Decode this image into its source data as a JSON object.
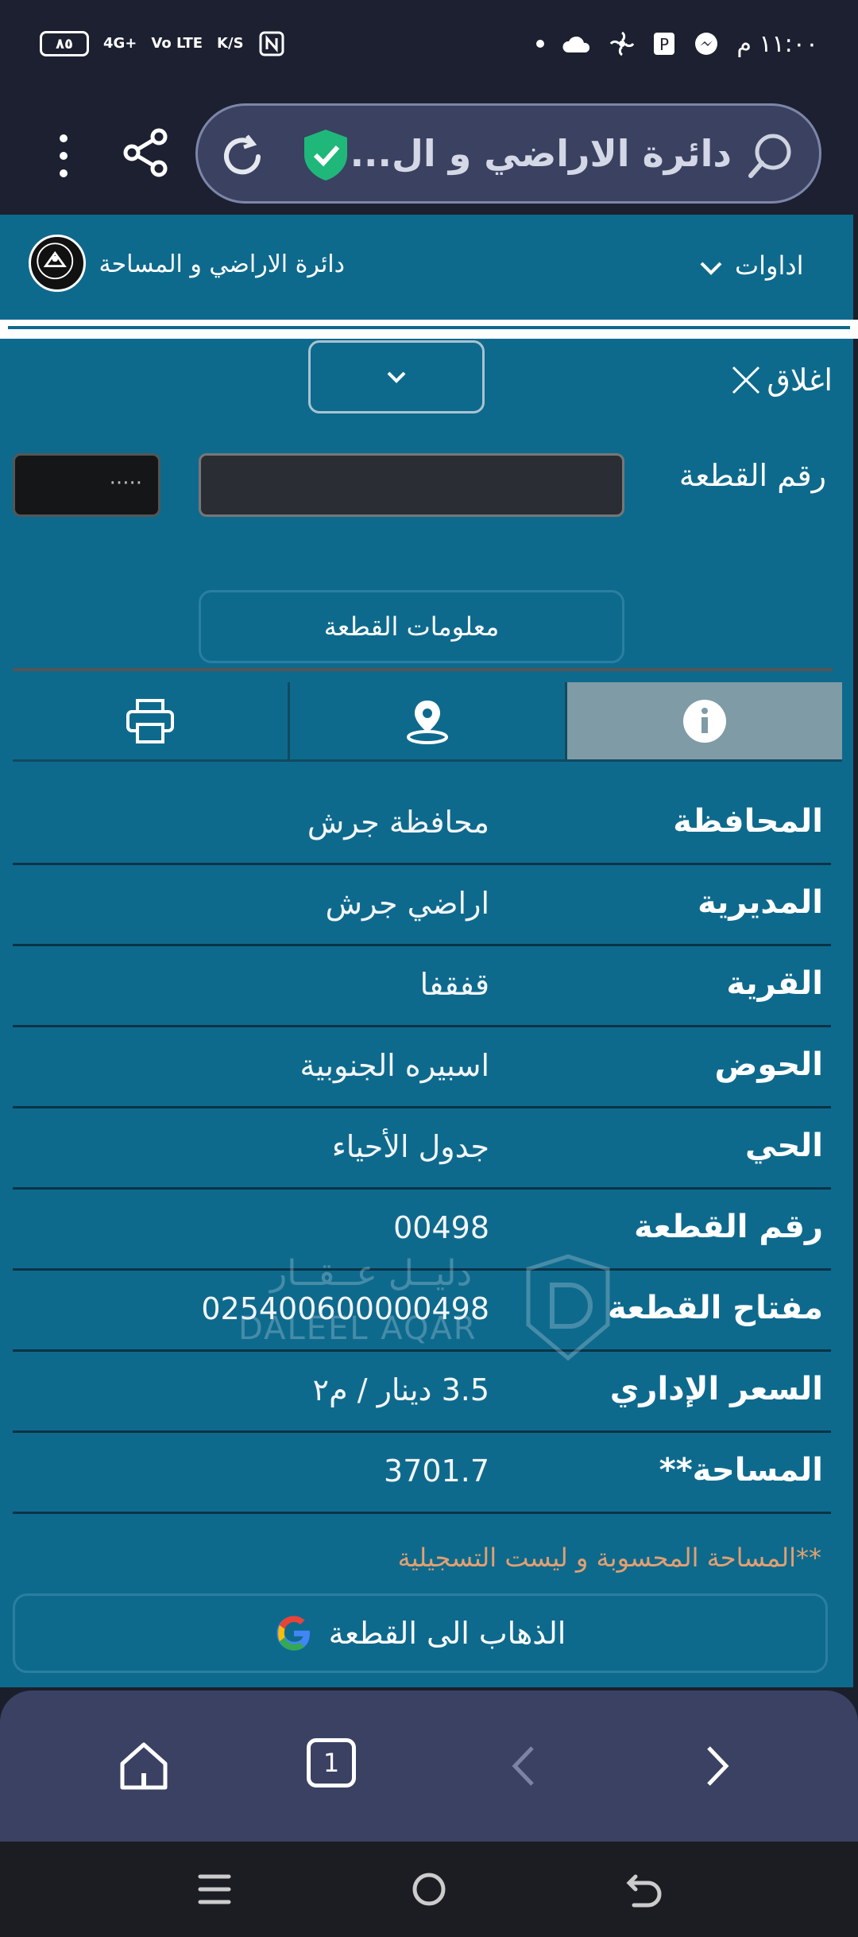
{
  "status_bar": {
    "time": "١١:٠٠ م",
    "battery": "٨٥",
    "network": "4G+",
    "volte": "Vo LTE",
    "speed": "K/S"
  },
  "browser": {
    "url_title": "دائرة الاراضي و ال...",
    "tab_count": "1"
  },
  "site": {
    "title": "دائرة الاراضي و المساحة",
    "tools_label": "اداوات"
  },
  "panel": {
    "close_label": "اغلاق",
    "plot_number_label": "رقم القطعة",
    "small_input_value": "·····",
    "plot_info_button": "معلومات القطعة",
    "fields": [
      {
        "key": "المحافظة",
        "value": "محافظة جرش"
      },
      {
        "key": "المديرية",
        "value": "اراضي جرش"
      },
      {
        "key": "القرية",
        "value": "قفقفا"
      },
      {
        "key": "الحوض",
        "value": "اسبيره الجنوبية"
      },
      {
        "key": "الحي",
        "value": "جدول الأحياء"
      },
      {
        "key": "رقم القطعة",
        "value": "00498"
      },
      {
        "key": "مفتاح القطعة",
        "value": "025400600000498"
      },
      {
        "key": "السعر الإداري",
        "value": "3.5 دينار / م٢"
      },
      {
        "key": "المساحة**",
        "value": "3701.7"
      }
    ],
    "area_note": "**المساحة المحسوبة و ليست التسجيلية",
    "go_button": "الذهاب الى القطعة"
  },
  "watermark": {
    "ar": "دليــل عــقــار",
    "en": "DALEEL AQAR"
  },
  "colors": {
    "panel_bg": "#0e6a8d",
    "active_tab": "#7f9ba6",
    "note": "#e2a071",
    "toolbar": "#3b4163"
  }
}
